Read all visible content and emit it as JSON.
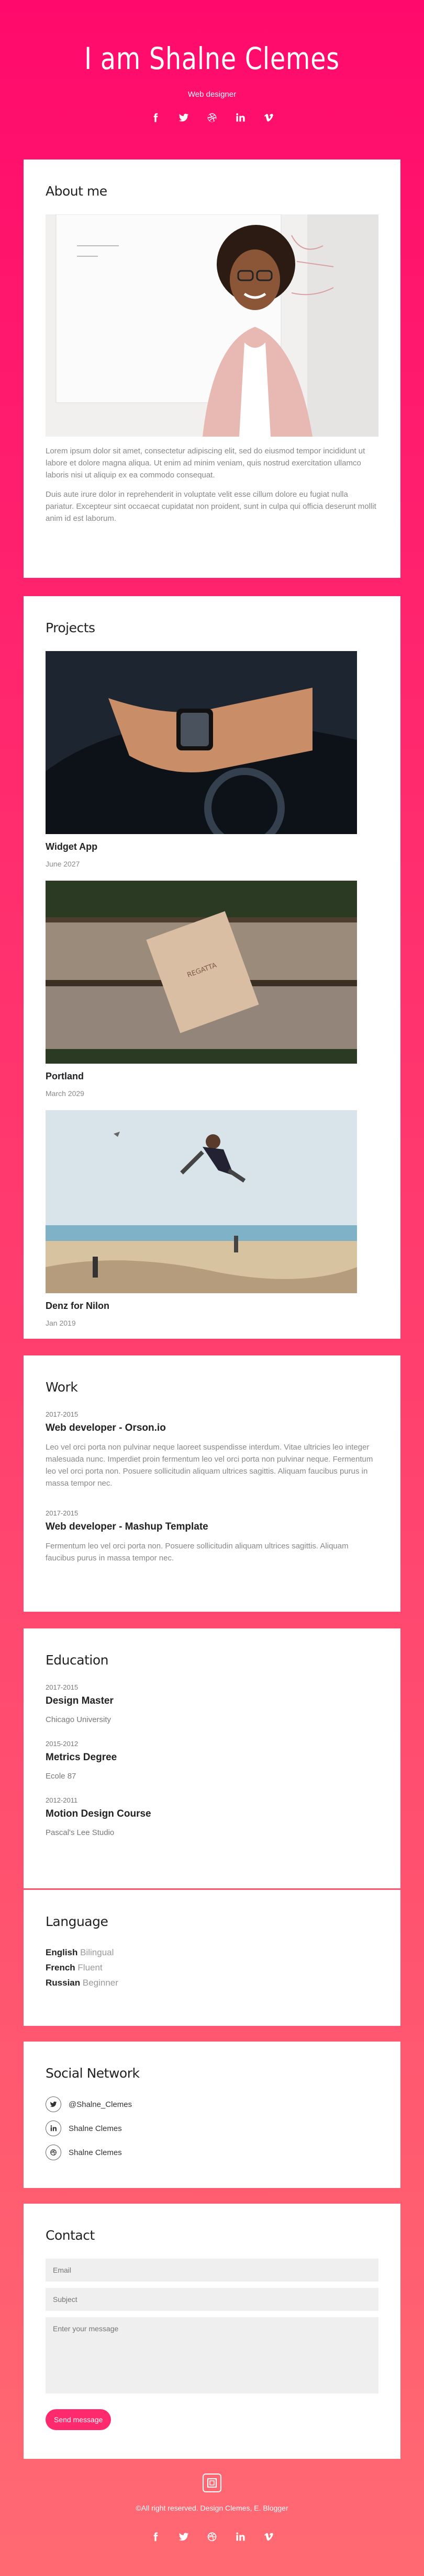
{
  "header": {
    "title": "I am Shalne Clemes",
    "subtitle": "Web designer",
    "socials": [
      "facebook-icon",
      "twitter-icon",
      "dribbble-icon",
      "linkedin-icon",
      "vimeo-icon"
    ]
  },
  "about": {
    "heading": "About me",
    "para1": "Lorem ipsum dolor sit amet, consectetur adipiscing elit, sed do eiusmod tempor incididunt ut labore et dolore magna aliqua. Ut enim ad minim veniam, quis nostrud exercitation ullamco laboris nisi ut aliquip ex ea commodo consequat.",
    "para2": "Duis aute irure dolor in reprehenderit in voluptate velit esse cillum dolore eu fugiat nulla pariatur. Excepteur sint occaecat cupidatat non proident, sunt in culpa qui officia deserunt mollit anim id est laborum."
  },
  "projects": {
    "heading": "Projects",
    "items": [
      {
        "title": "Widget App",
        "date": "June 2027"
      },
      {
        "title": "Portland",
        "date": "March 2029"
      },
      {
        "title": "Denz for Nilon",
        "date": "Jan 2019"
      }
    ]
  },
  "work": {
    "heading": "Work",
    "items": [
      {
        "years": "2017-2015",
        "title": "Web developer - Orson.io",
        "text": "Leo vel orci porta non pulvinar neque laoreet suspendisse interdum. Vitae ultricies leo integer malesuada nunc. Imperdiet proin fermentum leo vel orci porta non pulvinar neque. Fermentum leo vel orci porta non. Posuere sollicitudin aliquam ultrices sagittis. Aliquam faucibus purus in massa tempor nec."
      },
      {
        "years": "2017-2015",
        "title": "Web developer - Mashup Template",
        "text": "Fermentum leo vel orci porta non. Posuere sollicitudin aliquam ultrices sagittis. Aliquam faucibus purus in massa tempor nec."
      }
    ]
  },
  "education": {
    "heading": "Education",
    "items": [
      {
        "years": "2017-2015",
        "title": "Design Master",
        "place": "Chicago University"
      },
      {
        "years": "2015-2012",
        "title": "Metrics Degree",
        "place": "Ecole 87"
      },
      {
        "years": "2012-2011",
        "title": "Motion Design Course",
        "place": "Pascal's Lee Studio"
      }
    ]
  },
  "language": {
    "heading": "Language",
    "items": [
      {
        "name": "English",
        "level": "Bilingual"
      },
      {
        "name": "French",
        "level": "Fluent"
      },
      {
        "name": "Russian",
        "level": "Beginner"
      }
    ]
  },
  "social": {
    "heading": "Social Network",
    "items": [
      {
        "icon": "twitter-icon",
        "label": "@Shalne_Clemes"
      },
      {
        "icon": "linkedin-icon",
        "label": "Shalne Clemes"
      },
      {
        "icon": "dribbble-icon",
        "label": "Shalne Clemes"
      }
    ]
  },
  "contact": {
    "heading": "Contact",
    "email_placeholder": "Email",
    "subject_placeholder": "Subject",
    "message_placeholder": "Enter your message",
    "send_label": "Send message"
  },
  "footer": {
    "text": "©All right reserved. Design Clemes, E. Blogger"
  }
}
